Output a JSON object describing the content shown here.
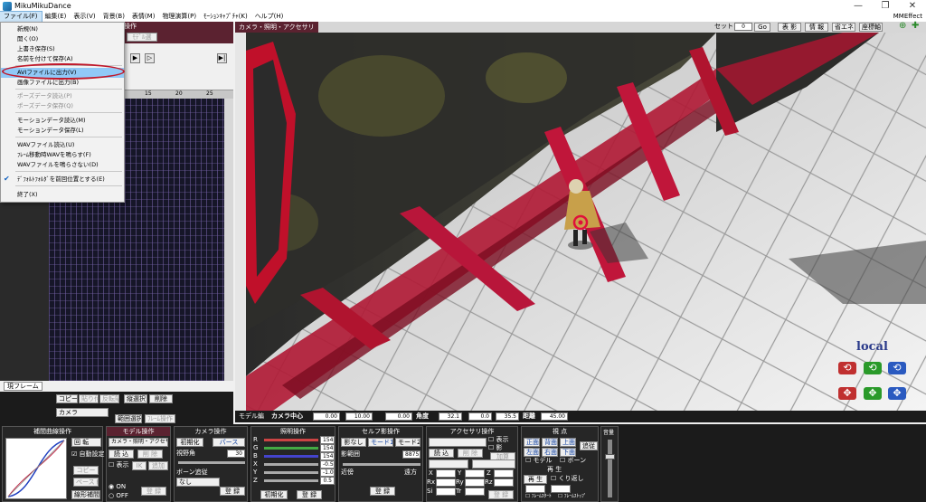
{
  "window": {
    "title": "MikuMikuDance",
    "right_label": "MMEffect",
    "min": "—",
    "max": "❐",
    "close": "✕"
  },
  "menu": [
    "ファイル(F)",
    "編集(E)",
    "表示(V)",
    "背景(B)",
    "表情(M)",
    "物理演算(P)",
    "ﾓｰｼｮﾝｷｬﾌﾟﾁｬ(K)",
    "ヘルプ(H)"
  ],
  "file_menu": {
    "items": [
      {
        "label": "新規(N)",
        "state": "normal"
      },
      {
        "label": "開く(O)",
        "state": "normal"
      },
      {
        "label": "上書き保存(S)",
        "state": "normal"
      },
      {
        "label": "名前を付けて保存(A)",
        "state": "normal"
      },
      {
        "label": "AVIファイルに出力(V)",
        "state": "highlight"
      },
      {
        "label": "画像ファイルに出力(B)",
        "state": "normal"
      },
      {
        "label": "ポーズデータ読込(P)",
        "state": "disabled"
      },
      {
        "label": "ポーズデータ保存(Q)",
        "state": "disabled"
      },
      {
        "label": "モーションデータ読込(M)",
        "state": "normal"
      },
      {
        "label": "モーションデータ保存(L)",
        "state": "normal"
      },
      {
        "label": "WAVファイル読込(U)",
        "state": "normal"
      },
      {
        "label": "ﾌﾚｰﾑ移動時WAVを鳴らす(F)",
        "state": "normal"
      },
      {
        "label": "WAVファイルを鳴らさない(D)",
        "state": "normal"
      },
      {
        "label": "ﾃﾞﾌｫﾙﾄﾌｫﾙﾀﾞを前回位置とする(E)",
        "state": "checked"
      },
      {
        "label": "終了(X)",
        "state": "normal"
      }
    ]
  },
  "left_panel": {
    "header_label": "ム操作",
    "sub_button": "ﾓﾃﾞﾙ選",
    "ruler": [
      "15",
      "20",
      "25"
    ],
    "current_frame_label": "現フレーム",
    "buttons": {
      "copy": "コピー",
      "paste": "貼り付け",
      "reverse": "反転貼付",
      "range_select": "縦選択",
      "delete": "削除",
      "range_set": "範囲選択",
      "expand": "ﾌﾚｰﾑ操作"
    },
    "target_select": "カメラ"
  },
  "viewport": {
    "title": "カメラ・照明・アクセサリ",
    "tools": {
      "set_label": "セット",
      "frame_value": "0",
      "go": "Go",
      "shadow": "表 影",
      "info": "情 報",
      "energy": "省エネ",
      "coords": "座標軸"
    },
    "local_label": "local",
    "status": {
      "mode": "モデル編",
      "camera_center": "カメラ中心",
      "cx": "0.00",
      "cy": "10.00",
      "cz": "0.00",
      "angle": "角度",
      "ax": "32.1",
      "ay": "0.0",
      "az": "35.5",
      "distance_label": "距離",
      "distance": "45.00"
    }
  },
  "panels": {
    "interp": {
      "title": "補間曲線操作",
      "rotate": "回 転",
      "auto": "自動設定",
      "copy": "コピー",
      "paste": "ペースト",
      "linear": "線形補間"
    },
    "model": {
      "title": "モデル操作",
      "selected": "カメラ・照明・アクセサリ",
      "load": "読 込",
      "delete": "削 除",
      "show": "表示",
      "ik": "IK",
      "add": "追加",
      "on": "ON",
      "off": "OFF",
      "register": "登 録"
    },
    "camera": {
      "title": "カメラ操作",
      "init": "初期化",
      "perspective": "パース",
      "fov_label": "視野角",
      "fov": "30",
      "follow_label": "ボーン追従",
      "follow": "なし",
      "register": "登 録"
    },
    "light": {
      "title": "照明操作",
      "r_label": "R",
      "g_label": "G",
      "b_label": "B",
      "x_label": "X",
      "y_label": "Y",
      "z_label": "Z",
      "r": "154",
      "g": "154",
      "b": "154",
      "x": "-0.5",
      "y": "-1.0",
      "z": "0.5",
      "init": "初期化",
      "register": "登 録"
    },
    "self_shadow": {
      "title": "セルフ影操作",
      "no_shadow": "影なし",
      "mode1": "モード1",
      "mode2": "モード2",
      "range_label": "影範囲",
      "range": "8875",
      "near": "近傍",
      "far": "遠方",
      "register": "登 録"
    },
    "accessory": {
      "title": "アクセサリ操作",
      "load": "読 込",
      "delete": "削 除",
      "show": "表示",
      "shadow": "影",
      "add": "加算",
      "x": "X",
      "y": "Y",
      "z": "Z",
      "rx": "Rx",
      "ry": "Ry",
      "rz": "Rz",
      "si": "Si",
      "tr": "Tr",
      "register": "登 録"
    },
    "view": {
      "title": "視 点",
      "front": "正面",
      "back": "背面",
      "top": "上面",
      "left": "左面",
      "right": "右面",
      "bottom": "下面",
      "track": "追従",
      "model": "モデル",
      "bone": "ボーン",
      "play": "再 生",
      "repeat": "くり返し",
      "frame_start": "ﾌﾚｰﾑｽﾀｰﾄ",
      "frame_stop": "ﾌﾚｰﾑｽﾄｯﾌﾟ",
      "volume": "音量",
      "play_title": "再 生"
    }
  }
}
